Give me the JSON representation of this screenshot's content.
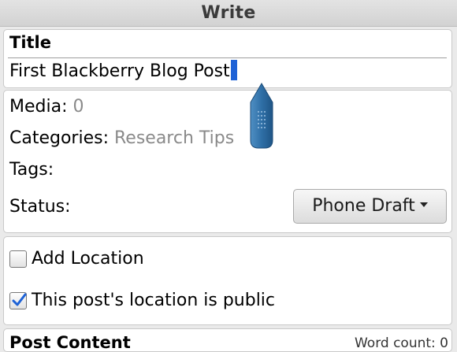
{
  "header": {
    "title": "Write"
  },
  "title_field": {
    "label": "Title",
    "value": "First Blackberry Blog Post"
  },
  "meta": {
    "media_label": "Media:",
    "media_value": "0",
    "categories_label": "Categories:",
    "categories_value": "Research Tips",
    "tags_label": "Tags:",
    "status_label": "Status:",
    "status_value": "Phone Draft"
  },
  "location": {
    "add_location_label": "Add Location",
    "add_location_checked": false,
    "public_label": "This post's location is public",
    "public_checked": true
  },
  "content": {
    "label": "Post Content",
    "word_count_label": "Word count: 0"
  },
  "colors": {
    "caret": "#1e62d6",
    "cursor_handle": "#2f6fa6",
    "check": "#1e62d6"
  },
  "icons": {
    "cursor_handle": "cursor-handle-icon",
    "checkmark": "checkmark-icon",
    "dropdown_arrow": "dropdown-arrow-icon"
  }
}
